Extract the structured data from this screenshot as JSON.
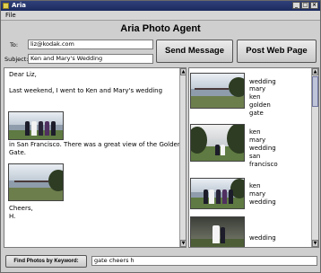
{
  "window": {
    "title": "Aria",
    "controls": [
      "_",
      "□",
      "×"
    ]
  },
  "menu": {
    "file": "File"
  },
  "app_title": "Aria Photo Agent",
  "compose": {
    "to_label": "To:",
    "to_value": "liz@kodak.com",
    "subject_label": "Subject:",
    "subject_value": "Ken and Mary's Wedding"
  },
  "buttons": {
    "send": "Send Message",
    "post": "Post Web Page",
    "find": "Find Photos by Keyword:"
  },
  "letter": {
    "greeting": "Dear Liz,",
    "line1": "Last weekend, I went to Ken and Mary's wedding",
    "line2": "in San Francisco. There was a great view of the Golden",
    "line3": "Gate.",
    "closing": "Cheers,",
    "signature": "H."
  },
  "results": [
    {
      "keywords": [
        "wedding",
        "mary",
        "ken",
        "golden",
        "gate"
      ]
    },
    {
      "keywords": [
        "ken",
        "mary",
        "wedding",
        "san",
        "francisco"
      ]
    },
    {
      "keywords": [
        "ken",
        "mary",
        "wedding"
      ]
    },
    {
      "keywords": [
        "wedding"
      ]
    }
  ],
  "keyword_query": "gate cheers h",
  "scrollbar_arrows": {
    "up": "▲",
    "down": "▼"
  }
}
